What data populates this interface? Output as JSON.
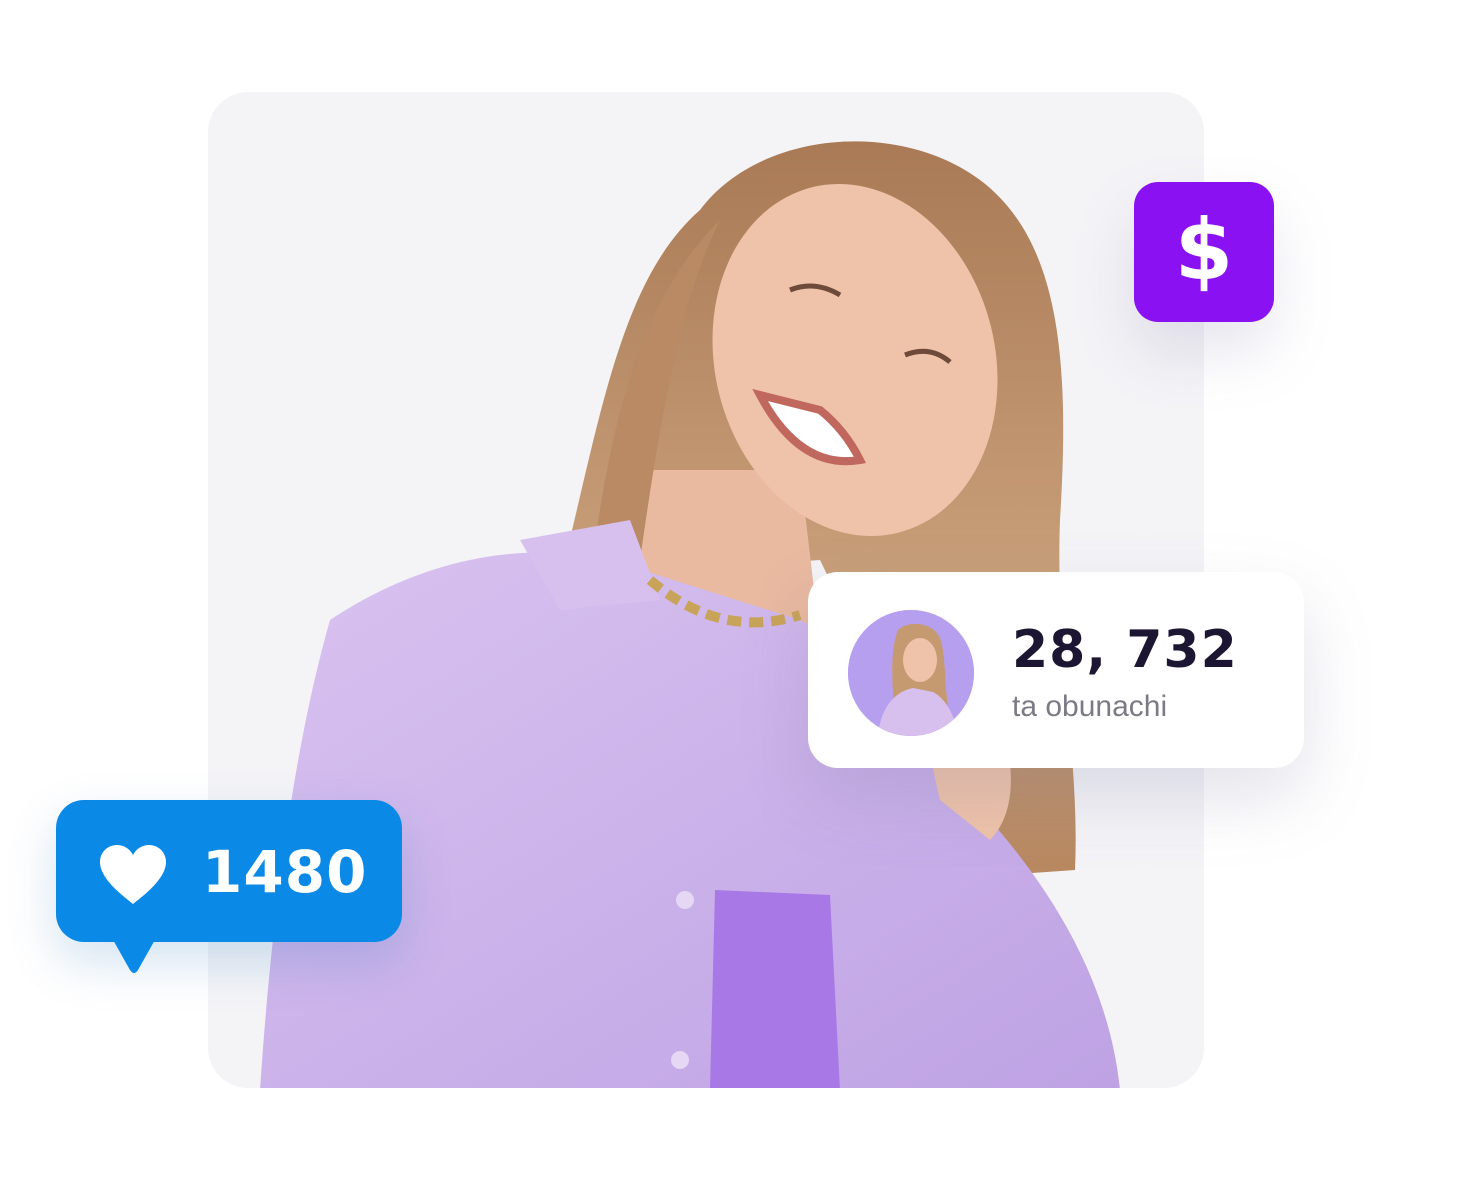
{
  "money_badge": {
    "icon": "dollar-icon",
    "glyph": "$",
    "color": "#8a12f2"
  },
  "followers_card": {
    "count": "28, 732",
    "label": "ta obunachi"
  },
  "like_bubble": {
    "icon": "heart-icon",
    "count": "1480",
    "color": "#0a8ae6"
  },
  "colors": {
    "shirt": "#cdb3ec",
    "top": "#a879e6",
    "hair": "#b98a63",
    "skin": "#efc3aa",
    "card_background": "#f4f4f7"
  }
}
